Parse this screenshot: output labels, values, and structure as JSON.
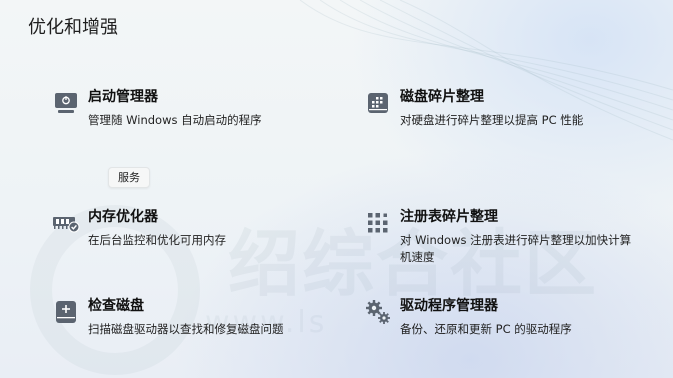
{
  "page": {
    "title": "优化和增强"
  },
  "tooltip": {
    "text": "服务"
  },
  "watermark": {
    "text": "绍综合社区",
    "url": "www.ls"
  },
  "items": [
    {
      "title": "启动管理器",
      "desc": "管理随 Windows 自动启动的程序",
      "icon": "startup-monitor-icon"
    },
    {
      "title": "磁盘碎片整理",
      "desc": "对硬盘进行碎片整理以提高 PC 性能",
      "icon": "disk-defrag-icon"
    },
    {
      "title": "内存优化器",
      "desc": "在后台监控和优化可用内存",
      "icon": "memory-chip-icon"
    },
    {
      "title": "注册表碎片整理",
      "desc": "对 Windows 注册表进行碎片整理以加快计算机速度",
      "icon": "registry-grid-icon"
    },
    {
      "title": "检查磁盘",
      "desc": "扫描磁盘驱动器以查找和修复磁盘问题",
      "icon": "disk-check-icon"
    },
    {
      "title": "驱动程序管理器",
      "desc": "备份、还原和更新 PC 的驱动程序",
      "icon": "gears-icon"
    }
  ]
}
